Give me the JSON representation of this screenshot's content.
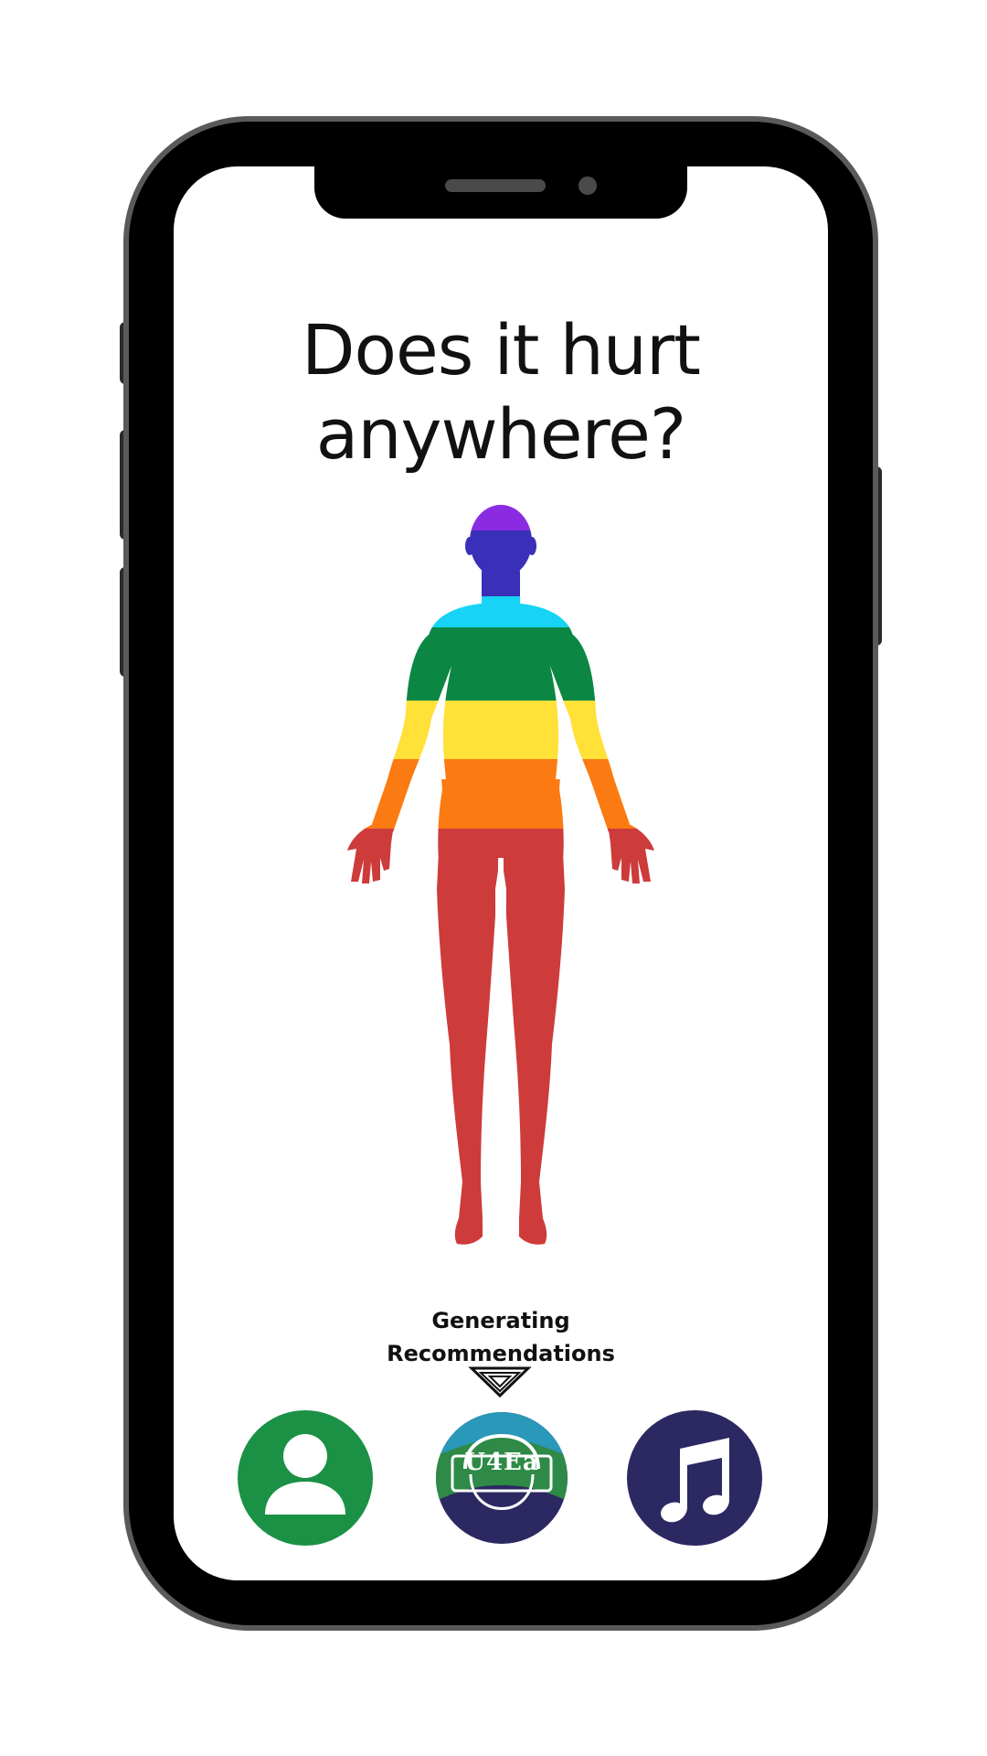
{
  "screen": {
    "title_line1": "Does it hurt",
    "title_line2": "anywhere?"
  },
  "body_map": {
    "zones": [
      {
        "name": "crown",
        "color": "#8a2be2"
      },
      {
        "name": "head",
        "color": "#3a2fb8"
      },
      {
        "name": "neck-shoulders",
        "color": "#17d3f5"
      },
      {
        "name": "chest",
        "color": "#0b8743"
      },
      {
        "name": "abdomen",
        "color": "#ffe138"
      },
      {
        "name": "pelvis",
        "color": "#fb7a11"
      },
      {
        "name": "legs",
        "color": "#cd3b3b"
      }
    ]
  },
  "status": {
    "line1": "Generating",
    "line2": "Recommendations"
  },
  "nav": {
    "logo_text": "U4Ea",
    "profile_icon": "user-icon",
    "music_icon": "music-note-icon"
  },
  "colors": {
    "profile_bg": "#1a9145",
    "music_bg": "#2c2862",
    "logo_top": "#2a98b8",
    "logo_mid": "#2e8a46",
    "logo_bottom": "#2c2862"
  }
}
